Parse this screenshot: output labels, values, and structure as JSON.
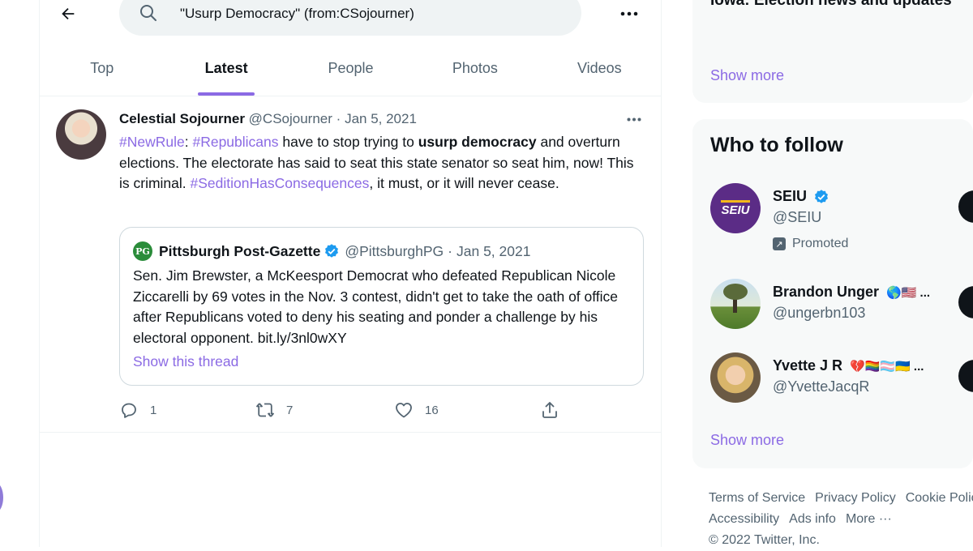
{
  "colors": {
    "accent": "#8b6ae4",
    "verified": "#1d9bf0",
    "muted": "#536471",
    "text": "#0f1419"
  },
  "search": {
    "query": "\"Usurp Democracy\" (from:CSojourner)"
  },
  "tabs": [
    {
      "label": "Top"
    },
    {
      "label": "Latest",
      "active": true
    },
    {
      "label": "People"
    },
    {
      "label": "Photos"
    },
    {
      "label": "Videos"
    }
  ],
  "tweet": {
    "name": "Celestial Sojourner",
    "handle": "@CSojourner",
    "separator": "·",
    "date": "Jan 5, 2021",
    "text": {
      "hashtag1": "#NewRule",
      "p1": ": ",
      "hashtag2": "#Republicans",
      "p2": " have to stop trying to ",
      "bold": "usurp democracy",
      "p3": " and overturn elections.  The electorate has said to seat this state senator so seat him, now! This is criminal. ",
      "hashtag3": "#SeditionHasConsequences",
      "p4": ", it must, or it will never cease."
    },
    "quote": {
      "logo_text": "PG",
      "name": "Pittsburgh Post-Gazette",
      "handle": "@PittsburghPG",
      "separator": "·",
      "date": "Jan 5, 2021",
      "text": "Sen. Jim Brewster, a McKeesport Democrat who defeated Republican Nicole Ziccarelli by 69 votes in the Nov. 3 contest, didn't get to take the oath of office after Republicans voted to deny his seating and ponder a challenge by his electoral opponent. bit.ly/3nl0wXY",
      "show_thread": "Show this thread"
    },
    "actions": {
      "replies": "1",
      "retweets": "7",
      "likes": "16"
    }
  },
  "sidebar": {
    "trend_title": "Iowa: Election news and updates",
    "trend_show_more": "Show more",
    "who_to_follow": {
      "title": "Who to follow",
      "items": [
        {
          "name": "SEIU",
          "handle": "@SEIU",
          "verified": true,
          "promoted": "Promoted",
          "logo_text": "SEIU"
        },
        {
          "name": "Brandon Unger",
          "handle": "@ungerbn103",
          "emoji": "🌎🇺🇸 ..."
        },
        {
          "name": "Yvette J R",
          "handle": "@YvetteJacqR",
          "emoji": "💔🏳️‍🌈🏳️‍⚧️🇺🇦 ..."
        }
      ],
      "show_more": "Show more"
    },
    "footer": {
      "links_row1": [
        "Terms of Service",
        "Privacy Policy",
        "Cookie Policy"
      ],
      "links_row2": [
        "Accessibility",
        "Ads info",
        "More ···"
      ],
      "copyright": "© 2022 Twitter, Inc."
    }
  }
}
